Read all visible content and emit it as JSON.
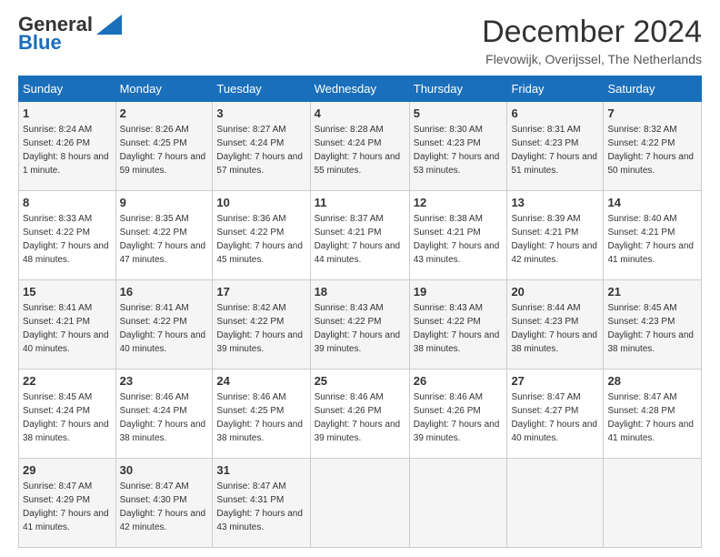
{
  "logo": {
    "line1": "General",
    "line2": "Blue"
  },
  "title": "December 2024",
  "location": "Flevowijk, Overijssel, The Netherlands",
  "weekdays": [
    "Sunday",
    "Monday",
    "Tuesday",
    "Wednesday",
    "Thursday",
    "Friday",
    "Saturday"
  ],
  "weeks": [
    [
      {
        "day": "1",
        "sunrise": "8:24 AM",
        "sunset": "4:26 PM",
        "daylight": "8 hours and 1 minute."
      },
      {
        "day": "2",
        "sunrise": "8:26 AM",
        "sunset": "4:25 PM",
        "daylight": "7 hours and 59 minutes."
      },
      {
        "day": "3",
        "sunrise": "8:27 AM",
        "sunset": "4:24 PM",
        "daylight": "7 hours and 57 minutes."
      },
      {
        "day": "4",
        "sunrise": "8:28 AM",
        "sunset": "4:24 PM",
        "daylight": "7 hours and 55 minutes."
      },
      {
        "day": "5",
        "sunrise": "8:30 AM",
        "sunset": "4:23 PM",
        "daylight": "7 hours and 53 minutes."
      },
      {
        "day": "6",
        "sunrise": "8:31 AM",
        "sunset": "4:23 PM",
        "daylight": "7 hours and 51 minutes."
      },
      {
        "day": "7",
        "sunrise": "8:32 AM",
        "sunset": "4:22 PM",
        "daylight": "7 hours and 50 minutes."
      }
    ],
    [
      {
        "day": "8",
        "sunrise": "8:33 AM",
        "sunset": "4:22 PM",
        "daylight": "7 hours and 48 minutes."
      },
      {
        "day": "9",
        "sunrise": "8:35 AM",
        "sunset": "4:22 PM",
        "daylight": "7 hours and 47 minutes."
      },
      {
        "day": "10",
        "sunrise": "8:36 AM",
        "sunset": "4:22 PM",
        "daylight": "7 hours and 45 minutes."
      },
      {
        "day": "11",
        "sunrise": "8:37 AM",
        "sunset": "4:21 PM",
        "daylight": "7 hours and 44 minutes."
      },
      {
        "day": "12",
        "sunrise": "8:38 AM",
        "sunset": "4:21 PM",
        "daylight": "7 hours and 43 minutes."
      },
      {
        "day": "13",
        "sunrise": "8:39 AM",
        "sunset": "4:21 PM",
        "daylight": "7 hours and 42 minutes."
      },
      {
        "day": "14",
        "sunrise": "8:40 AM",
        "sunset": "4:21 PM",
        "daylight": "7 hours and 41 minutes."
      }
    ],
    [
      {
        "day": "15",
        "sunrise": "8:41 AM",
        "sunset": "4:21 PM",
        "daylight": "7 hours and 40 minutes."
      },
      {
        "day": "16",
        "sunrise": "8:41 AM",
        "sunset": "4:22 PM",
        "daylight": "7 hours and 40 minutes."
      },
      {
        "day": "17",
        "sunrise": "8:42 AM",
        "sunset": "4:22 PM",
        "daylight": "7 hours and 39 minutes."
      },
      {
        "day": "18",
        "sunrise": "8:43 AM",
        "sunset": "4:22 PM",
        "daylight": "7 hours and 39 minutes."
      },
      {
        "day": "19",
        "sunrise": "8:43 AM",
        "sunset": "4:22 PM",
        "daylight": "7 hours and 38 minutes."
      },
      {
        "day": "20",
        "sunrise": "8:44 AM",
        "sunset": "4:23 PM",
        "daylight": "7 hours and 38 minutes."
      },
      {
        "day": "21",
        "sunrise": "8:45 AM",
        "sunset": "4:23 PM",
        "daylight": "7 hours and 38 minutes."
      }
    ],
    [
      {
        "day": "22",
        "sunrise": "8:45 AM",
        "sunset": "4:24 PM",
        "daylight": "7 hours and 38 minutes."
      },
      {
        "day": "23",
        "sunrise": "8:46 AM",
        "sunset": "4:24 PM",
        "daylight": "7 hours and 38 minutes."
      },
      {
        "day": "24",
        "sunrise": "8:46 AM",
        "sunset": "4:25 PM",
        "daylight": "7 hours and 38 minutes."
      },
      {
        "day": "25",
        "sunrise": "8:46 AM",
        "sunset": "4:26 PM",
        "daylight": "7 hours and 39 minutes."
      },
      {
        "day": "26",
        "sunrise": "8:46 AM",
        "sunset": "4:26 PM",
        "daylight": "7 hours and 39 minutes."
      },
      {
        "day": "27",
        "sunrise": "8:47 AM",
        "sunset": "4:27 PM",
        "daylight": "7 hours and 40 minutes."
      },
      {
        "day": "28",
        "sunrise": "8:47 AM",
        "sunset": "4:28 PM",
        "daylight": "7 hours and 41 minutes."
      }
    ],
    [
      {
        "day": "29",
        "sunrise": "8:47 AM",
        "sunset": "4:29 PM",
        "daylight": "7 hours and 41 minutes."
      },
      {
        "day": "30",
        "sunrise": "8:47 AM",
        "sunset": "4:30 PM",
        "daylight": "7 hours and 42 minutes."
      },
      {
        "day": "31",
        "sunrise": "8:47 AM",
        "sunset": "4:31 PM",
        "daylight": "7 hours and 43 minutes."
      },
      null,
      null,
      null,
      null
    ]
  ],
  "labels": {
    "sunrise": "Sunrise:",
    "sunset": "Sunset:",
    "daylight": "Daylight:"
  }
}
